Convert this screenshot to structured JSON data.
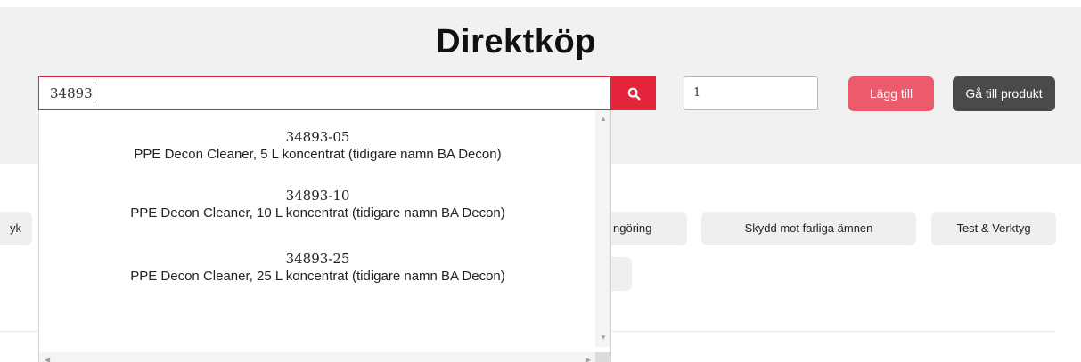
{
  "page": {
    "title": "Direktköp"
  },
  "search": {
    "value": "34893",
    "icon": "search-icon"
  },
  "quantity": {
    "value": "1"
  },
  "buttons": {
    "add_label": "Lägg till",
    "goto_label": "Gå till produkt"
  },
  "colors": {
    "accent": "#e3243b",
    "add_button": "#ec5b6c",
    "goto_button": "#4a4a4a",
    "header_band": "#f1f1f1"
  },
  "categories": [
    "yk",
    "ngöring",
    "Skydd mot farliga ämnen",
    "Test & Verktyg"
  ],
  "suggestions": [
    {
      "code": "34893-05",
      "name": "PPE Decon Cleaner, 5 L koncentrat (tidigare namn BA Decon)"
    },
    {
      "code": "34893-10",
      "name": "PPE Decon Cleaner, 10 L koncentrat (tidigare namn BA Decon)"
    },
    {
      "code": "34893-25",
      "name": "PPE Decon Cleaner, 25 L koncentrat (tidigare namn BA Decon)"
    }
  ]
}
